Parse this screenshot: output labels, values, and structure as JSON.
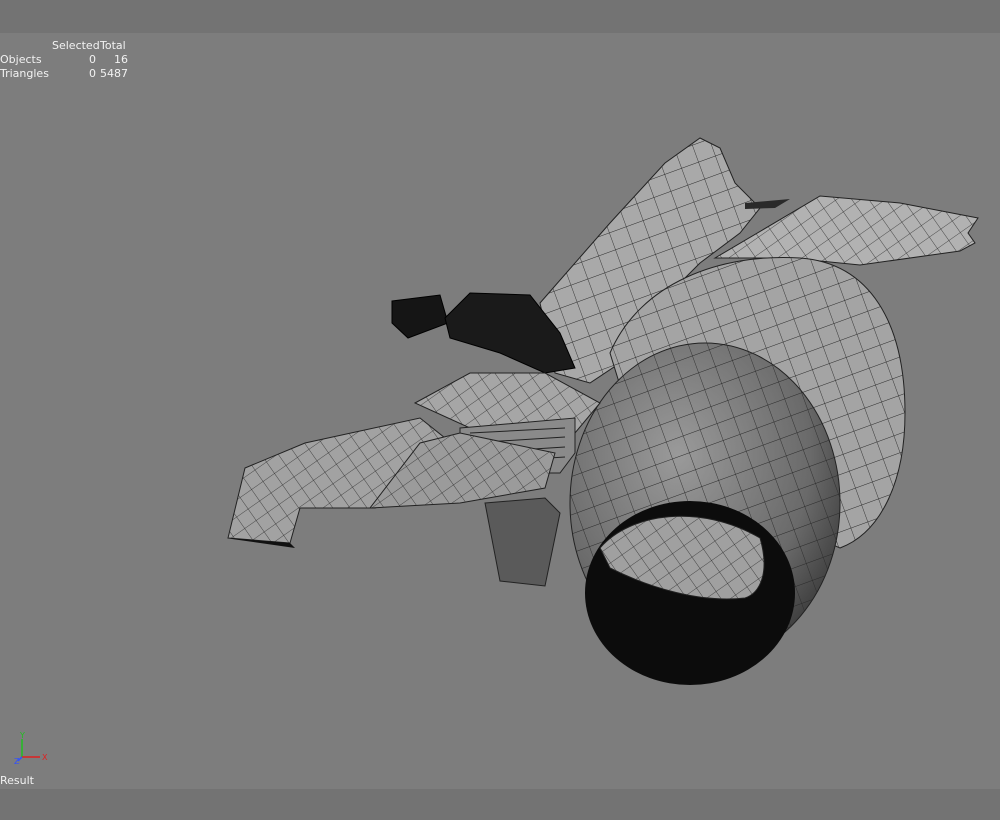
{
  "stats": {
    "header_selected": "Selected",
    "header_total": "Total",
    "rows": [
      {
        "label": "Objects",
        "selected": "0",
        "total": "16"
      },
      {
        "label": "Triangles",
        "selected": "0",
        "total": "5487"
      }
    ]
  },
  "axis": {
    "y": "Y",
    "x": "X",
    "z": "Z"
  },
  "status_label": "Result",
  "colors": {
    "viewport_bg": "#7d7d7d",
    "frame_bar": "#737373",
    "axis_x": "#e02020",
    "axis_y": "#20c020",
    "axis_z": "#3050ff"
  }
}
